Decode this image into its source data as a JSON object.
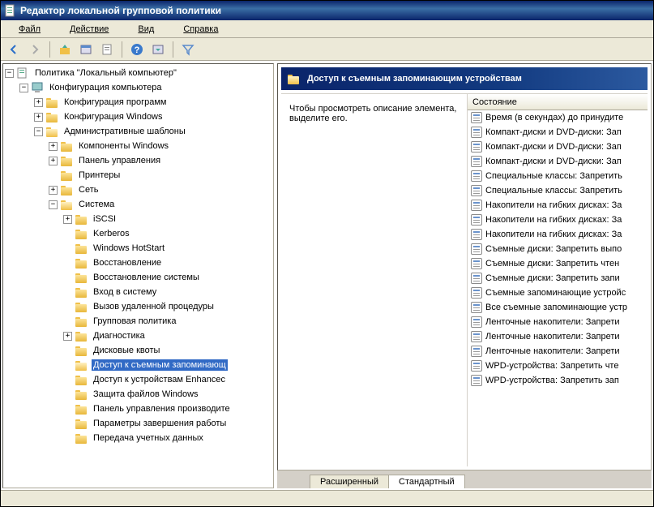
{
  "titlebar": {
    "title": "Редактор локальной групповой политики"
  },
  "menu": {
    "file": "Файл",
    "action": "Действие",
    "view": "Вид",
    "help": "Справка"
  },
  "tree": {
    "root": "Политика \"Локальный компьютер\"",
    "comp_config": "Конфигурация компьютера",
    "prog_config": "Конфигурация программ",
    "win_config": "Конфигурация Windows",
    "admin_templates": "Административные шаблоны",
    "win_components": "Компоненты Windows",
    "control_panel": "Панель управления",
    "printers": "Принтеры",
    "network": "Сеть",
    "system": "Система",
    "iscsi": "iSCSI",
    "kerberos": "Kerberos",
    "hotstart": "Windows HotStart",
    "recovery": "Восстановление",
    "sys_recovery": "Восстановление системы",
    "logon": "Вход в систему",
    "rpc": "Вызов удаленной процедуры",
    "gp": "Групповая политика",
    "diagnostics": "Диагностика",
    "quotas": "Дисковые квоты",
    "removable": "Доступ к съемным запоминающ",
    "enhanced": "Доступ к устройствам Enhancec",
    "wfp": "Защита файлов Windows",
    "perf": "Панель управления производите",
    "shutdown": "Параметры завершения работы",
    "creds": "Передача учетных данных"
  },
  "right": {
    "header": "Доступ к съемным запоминающим устройствам",
    "description": "Чтобы просмотреть описание элемента, выделите его.",
    "column": "Состояние",
    "items": [
      "Время (в секундах) до принудите",
      "Компакт-диски и DVD-диски: Зап",
      "Компакт-диски и DVD-диски: Зап",
      "Компакт-диски и DVD-диски: Зап",
      "Специальные классы: Запретить",
      "Специальные классы: Запретить",
      "Накопители на гибких дисках: За",
      "Накопители на гибких дисках: За",
      "Накопители на гибких дисках: За",
      "Съемные диски: Запретить выпо",
      "Съемные диски: Запретить чтен",
      "Съемные диски: Запретить запи",
      "Съемные запоминающие устройс",
      "Все съемные запоминающие устр",
      "Ленточные накопители: Запрети",
      "Ленточные накопители: Запрети",
      "Ленточные накопители: Запрети",
      "WPD-устройства: Запретить чте",
      "WPD-устройства: Запретить зап"
    ]
  },
  "tabs": {
    "extended": "Расширенный",
    "standard": "Стандартный"
  }
}
